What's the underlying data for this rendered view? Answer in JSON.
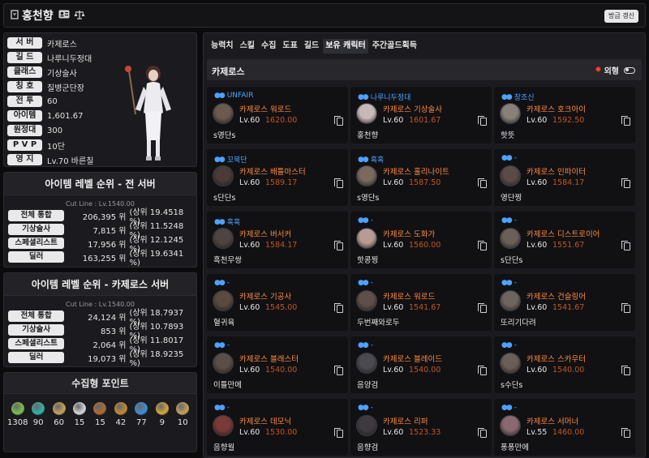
{
  "header": {
    "name": "홍천향",
    "refresh_label": "방금 갱신"
  },
  "profile": {
    "rows": [
      {
        "label": "서 버",
        "value": "카제로스"
      },
      {
        "label": "길 드",
        "value": "나루니두정대"
      },
      {
        "label": "클래스",
        "value": "기상술사"
      },
      {
        "label": "칭 호",
        "value": "질병군단장"
      },
      {
        "label": "전 투",
        "value": "60"
      },
      {
        "label": "아이템",
        "value": "1,601.67"
      },
      {
        "label": "원정대",
        "value": "300"
      },
      {
        "label": "P V P",
        "value": "10단"
      },
      {
        "label": "영 지",
        "value": "Lv.70 바른칠"
      }
    ]
  },
  "rank_all": {
    "title": "아이템 레벨 순위 - 전 서버",
    "cutline": "Cut Line : Lv.1540.00",
    "rows": [
      {
        "label": "전체 통합",
        "rank": "206,395 위",
        "pct": "(상위  19.4518 %)"
      },
      {
        "label": "기상술사",
        "rank": "7,815 위",
        "pct": "(상위  11.5248 %)"
      },
      {
        "label": "스페셜리스트",
        "rank": "17,956 위",
        "pct": "(상위  12.1245 %)"
      },
      {
        "label": "딜러",
        "rank": "163,255 위",
        "pct": "(상위  19.6341 %)"
      }
    ]
  },
  "rank_server": {
    "title": "아이템 레벨 순위 - 카제로스 서버",
    "cutline": "Cut Line : Lv.1540.00",
    "rows": [
      {
        "label": "전체 통합",
        "rank": "24,124 위",
        "pct": "(상위  18.7937 %)"
      },
      {
        "label": "기상술사",
        "rank": "853 위",
        "pct": "(상위  10.7893 %)"
      },
      {
        "label": "스페셜리스트",
        "rank": "2,064 위",
        "pct": "(상위  11.8017 %)"
      },
      {
        "label": "딜러",
        "rank": "19,073 위",
        "pct": "(상위  18.9235 %)"
      }
    ]
  },
  "collection": {
    "title": "수집형 포인트",
    "items": [
      {
        "icon": "mokoko-seed-icon",
        "value": "1308",
        "color": "#7cc24a"
      },
      {
        "icon": "island-heart-icon",
        "value": "90",
        "color": "#2fb3a8"
      },
      {
        "icon": "masterpiece-icon",
        "value": "60",
        "color": "#c9a25b"
      },
      {
        "icon": "giant-heart-icon",
        "value": "15",
        "color": "#d8d8dc"
      },
      {
        "icon": "ignea-token-icon",
        "value": "15",
        "color": "#b06b2c"
      },
      {
        "icon": "adventure-tome-icon",
        "value": "42",
        "color": "#c78a2e"
      },
      {
        "icon": "world-tree-leaf-icon",
        "value": "77",
        "color": "#3b8fd8"
      },
      {
        "icon": "orpheus-star-icon",
        "value": "9",
        "color": "#d8a63a"
      },
      {
        "icon": "sea-bounty-icon",
        "value": "10",
        "color": "#c9a25b"
      }
    ]
  },
  "tabs": [
    "능력치",
    "스킬",
    "수집",
    "도표",
    "길드",
    "보유 캐릭터",
    "주간골드획득"
  ],
  "active_tab": 5,
  "section": {
    "title": "카제로스",
    "toggle_label": "외형"
  },
  "characters": [
    {
      "guild": "UNFAIR",
      "server_class": "카제로스  워로드",
      "level": "Lv.60",
      "item_level": "1620.00",
      "name": "s영단s",
      "avatar": "#6b5a50"
    },
    {
      "guild": "나루니두정대",
      "server_class": "카제로스  기상술사",
      "level": "Lv.60",
      "item_level": "1601.67",
      "name": "홍천향",
      "avatar": "#c9b8b8"
    },
    {
      "guild": "창조신",
      "server_class": "카제로스  호크아이",
      "level": "Lv.60",
      "item_level": "1592.50",
      "name": "핫뜻",
      "avatar": "#8a8078"
    },
    {
      "guild": "꼬북단",
      "server_class": "카제로스  배틀마스터",
      "level": "Lv.60",
      "item_level": "1589.17",
      "name": "s단단s",
      "avatar": "#4a3a38"
    },
    {
      "guild": "혹혹",
      "server_class": "카제로스  홀리나이트",
      "level": "Lv.60",
      "item_level": "1587.50",
      "name": "s영단s",
      "avatar": "#7a6a5e"
    },
    {
      "guild": "-",
      "server_class": "카제로스  인파이터",
      "level": "Lv.60",
      "item_level": "1584.17",
      "name": "영단찡",
      "avatar": "#5a4a48"
    },
    {
      "guild": "혹혹",
      "server_class": "카제로스  버서커",
      "level": "Lv.60",
      "item_level": "1584.17",
      "name": "흑천무쌍",
      "avatar": "#4f4540"
    },
    {
      "guild": "-",
      "server_class": "카제로스  도화가",
      "level": "Lv.60",
      "item_level": "1560.00",
      "name": "핫콩찡",
      "avatar": "#b89c94"
    },
    {
      "guild": "-",
      "server_class": "카제로스  디스트로이어",
      "level": "Lv.60",
      "item_level": "1551.67",
      "name": "s단단s",
      "avatar": "#6a6058"
    },
    {
      "guild": "-",
      "server_class": "카제로스  기공사",
      "level": "Lv.60",
      "item_level": "1545.00",
      "name": "혈귀육",
      "avatar": "#5a4a40"
    },
    {
      "guild": "-",
      "server_class": "카제로스  워로드",
      "level": "Lv.60",
      "item_level": "1541.67",
      "name": "두번째와로두",
      "avatar": "#5e5048"
    },
    {
      "guild": "-",
      "server_class": "카제로스  건슬링어",
      "level": "Lv.60",
      "item_level": "1541.67",
      "name": "또리기다려",
      "avatar": "#6e6460"
    },
    {
      "guild": "-",
      "server_class": "카제로스  블래스터",
      "level": "Lv.60",
      "item_level": "1540.00",
      "name": "이틀만에",
      "avatar": "#5a4e48"
    },
    {
      "guild": "-",
      "server_class": "카제로스  블레이드",
      "level": "Lv.60",
      "item_level": "1540.00",
      "name": "음양검",
      "avatar": "#4a4a50"
    },
    {
      "guild": "-",
      "server_class": "카제로스  스카우터",
      "level": "Lv.60",
      "item_level": "1540.00",
      "name": "s수단s",
      "avatar": "#6a5e58"
    },
    {
      "guild": "-",
      "server_class": "카제로스  데모닉",
      "level": "Lv.60",
      "item_level": "1530.00",
      "name": "음향월",
      "avatar": "#7a3a38"
    },
    {
      "guild": "-",
      "server_class": "카제로스  리퍼",
      "level": "Lv.60",
      "item_level": "1523.33",
      "name": "음향검",
      "avatar": "#3e3a40"
    },
    {
      "guild": "-",
      "server_class": "카제로스  서머너",
      "level": "Lv.55",
      "item_level": "1460.00",
      "name": "퐁퐁만에",
      "avatar": "#8a6a70"
    }
  ]
}
